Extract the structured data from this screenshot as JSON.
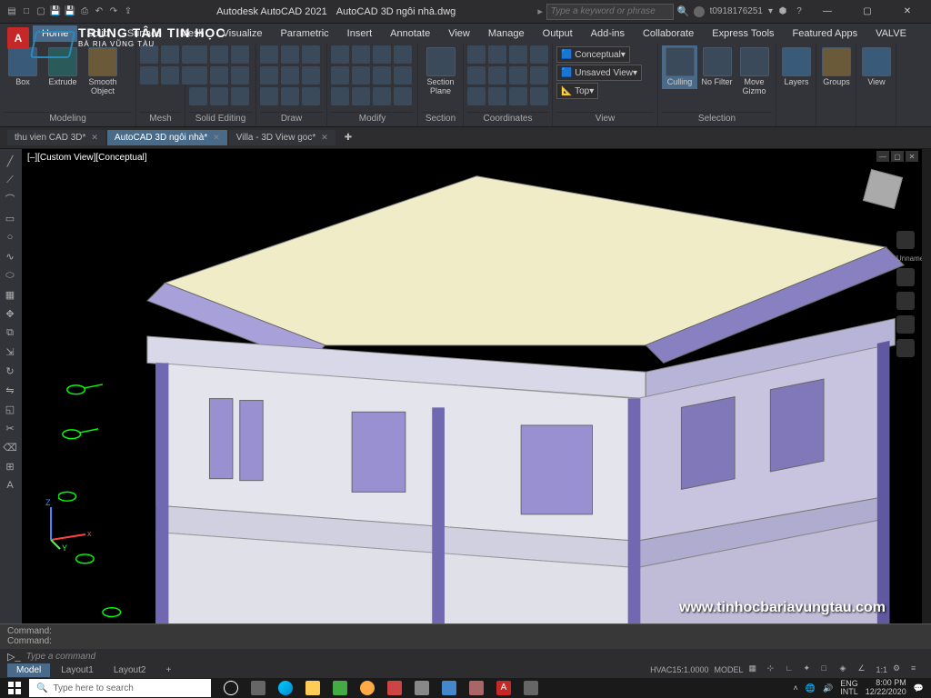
{
  "title": {
    "app": "Autodesk AutoCAD 2021",
    "doc": "AutoCAD 3D ngôi nhà.dwg"
  },
  "search_placeholder": "Type a keyword or phrase",
  "user": "t0918176251",
  "menu": [
    "Home",
    "Solid",
    "Surface",
    "Mesh",
    "Visualize",
    "Parametric",
    "Insert",
    "Annotate",
    "View",
    "Manage",
    "Output",
    "Add-ins",
    "Collaborate",
    "Express Tools",
    "Featured Apps",
    "VALVE"
  ],
  "ribbon": {
    "modeling": {
      "label": "Modeling",
      "box": "Box",
      "extrude": "Extrude",
      "smooth": "Smooth Object"
    },
    "mesh": {
      "label": "Mesh"
    },
    "solid": {
      "label": "Solid Editing"
    },
    "draw": {
      "label": "Draw"
    },
    "modify": {
      "label": "Modify"
    },
    "section": {
      "label": "Section",
      "plane": "Section Plane"
    },
    "coords": {
      "label": "Coordinates"
    },
    "view": {
      "label": "View",
      "style": "Conceptual",
      "saved": "Unsaved View",
      "top": "Top"
    },
    "selection": {
      "label": "Selection",
      "culling": "Culling",
      "filter": "No Filter",
      "gizmo": "Move Gizmo"
    },
    "layers": "Layers",
    "groups": "Groups",
    "viewbtn": "View"
  },
  "tabs": [
    {
      "name": "thu vien CAD 3D*"
    },
    {
      "name": "AutoCAD 3D ngôi nhà*"
    },
    {
      "name": "Villa - 3D View goc*"
    }
  ],
  "viewport_label": "[–][Custom View][Conceptual]",
  "navwheel": "Unnamed",
  "cmd": {
    "line1": "Command:",
    "line2": "Command:",
    "prompt": "Type a command"
  },
  "model_tabs": [
    "Model",
    "Layout1",
    "Layout2"
  ],
  "status": {
    "hvac": "HVAC15:1.0000",
    "model": "MODEL",
    "scale": "1:1"
  },
  "overlay": {
    "brand": "TRUNG TÂM TIN HỌC",
    "sub": "BÀ RỊA VŨNG TÀU"
  },
  "watermark": "www.tinhocbariavungtau.com",
  "taskbar": {
    "search": "Type here to search",
    "lang": "ENG",
    "ime": "INTL",
    "time": "8:00 PM",
    "date": "12/22/2020"
  }
}
